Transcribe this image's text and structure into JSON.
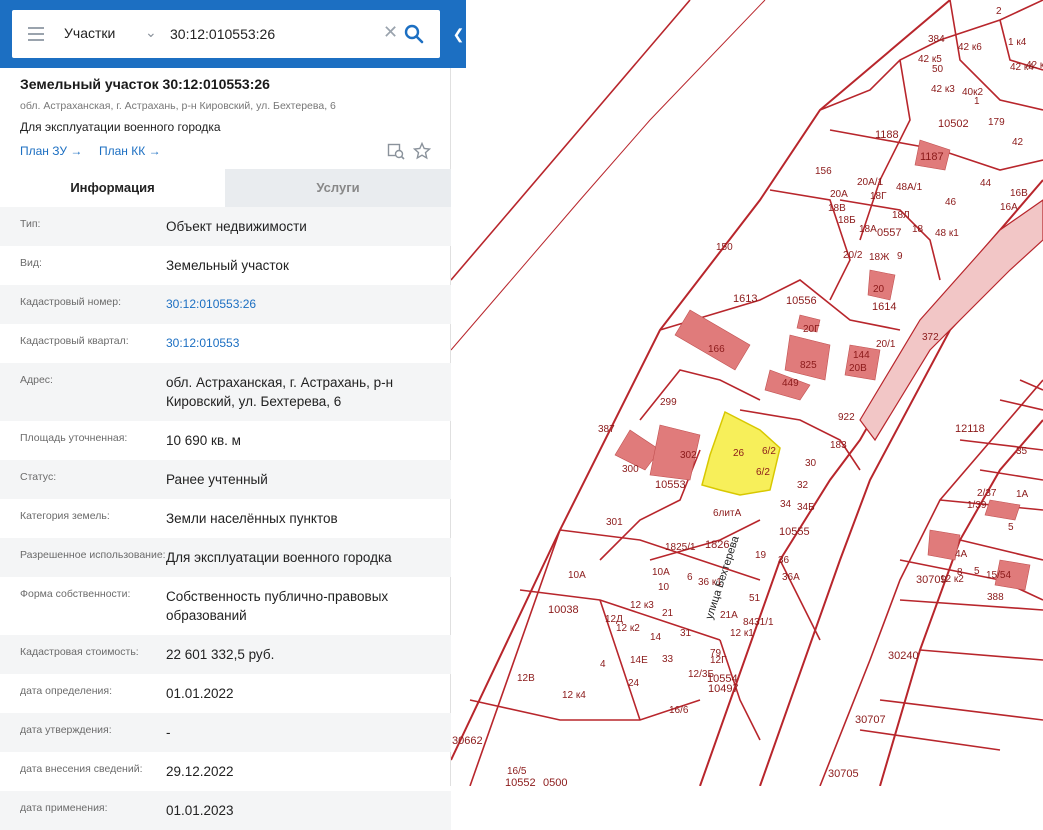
{
  "search": {
    "layer": "Участки",
    "value": "30:12:010553:26"
  },
  "object": {
    "title": "Земельный участок 30:12:010553:26",
    "address": "обл. Астраханская, г. Астрахань, р-н Кировский, ул. Бехтерева, 6",
    "use": "Для эксплуатации военного городка",
    "plan_zu": "План ЗУ →",
    "plan_kk": "План КК →"
  },
  "tabs": {
    "info": "Информация",
    "services": "Услуги"
  },
  "rows": [
    {
      "label": "Тип:",
      "value": "Объект недвижимости"
    },
    {
      "label": "Вид:",
      "value": "Земельный участок"
    },
    {
      "label": "Кадастровый номер:",
      "value": "30:12:010553:26"
    },
    {
      "label": "Кадастровый квартал:",
      "value": "30:12:010553"
    },
    {
      "label": "Адрес:",
      "value": "обл. Астраханская, г. Астрахань, р-н Кировский, ул. Бехтерева, 6"
    },
    {
      "label": "Площадь уточненная:",
      "value": "10 690 кв. м"
    },
    {
      "label": "Статус:",
      "value": "Ранее учтенный"
    },
    {
      "label": "Категория земель:",
      "value": "Земли населённых пунктов"
    },
    {
      "label": "Разрешенное использование:",
      "value": "Для эксплуатации военного городка"
    },
    {
      "label": "Форма собственности:",
      "value": "Собственность публично-правовых образований"
    },
    {
      "label": "Кадастровая стоимость:",
      "value": "22 601 332,5 руб."
    },
    {
      "label": "дата определения:",
      "value": "01.01.2022"
    },
    {
      "label": "дата утверждения:",
      "value": "-"
    },
    {
      "label": "дата внесения сведений:",
      "value": "29.12.2022"
    },
    {
      "label": "дата применения:",
      "value": "01.01.2023"
    }
  ],
  "map": {
    "parcel_color": "#b8262c",
    "highlight_color": "#f7ef5a",
    "street_label": "улица Бехтерева",
    "labels": [
      "2",
      "1 к4",
      "384",
      "42 к6",
      "42 к5",
      "50",
      "42 к4",
      "42 к3",
      "40к2",
      "1",
      "42 к2",
      "10502",
      "179",
      "1188",
      "1187",
      "42",
      "156",
      "20А/1",
      "48А/1",
      "44",
      "46",
      "16В",
      "16А",
      "20А",
      "18В",
      "18Б",
      "18Г",
      "18Л",
      "18А",
      "0557",
      "18",
      "48 к1",
      "150",
      "20/2",
      "18Ж",
      "9",
      "1613",
      "10556",
      "20",
      "1614",
      "20Г",
      "166",
      "372",
      "20/1",
      "825",
      "144",
      "20В",
      "449",
      "299",
      "922",
      "12118",
      "35",
      "1А",
      "387",
      "26",
      "6/2",
      "30",
      "183",
      "10553",
      "302",
      "300",
      "6/2",
      "32",
      "34",
      "34Б",
      "2/37",
      "1/39",
      "5",
      "6литА",
      "10555",
      "1825/1",
      "1826",
      "301",
      "19",
      "36",
      "36А",
      "4А",
      "10А",
      "6",
      "8",
      "15/54",
      "388",
      "10А",
      "5",
      "10",
      "36 к1",
      "51",
      "30709",
      "12 к2",
      "12 к3",
      "21",
      "21А",
      "8431/1",
      "10038",
      "12Д",
      "12 к2",
      "14",
      "31",
      "12 к1",
      "14Е",
      "33",
      "79",
      "12Г",
      "4",
      "12В",
      "10554",
      "10497",
      "12 к4",
      "24",
      "12/3Б",
      "16/6",
      "16/5",
      "10552",
      "0500",
      "30662",
      "30705",
      "30707",
      "30240"
    ]
  }
}
